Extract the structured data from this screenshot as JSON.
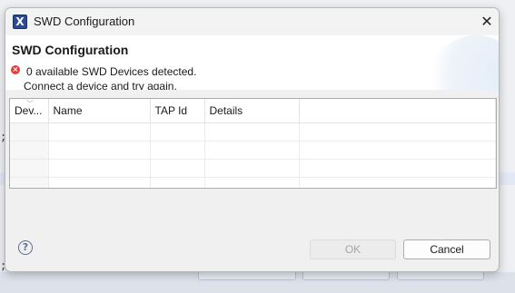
{
  "dialog": {
    "window_title": "SWD Configuration",
    "app_icon_glyph": "X",
    "close_glyph": "✕",
    "header_title": "SWD Configuration",
    "error_icon": "error-icon",
    "message_line1": "0 available SWD Devices detected.",
    "message_line2": "Connect a device and try again."
  },
  "table": {
    "columns": [
      "Dev...",
      "Name",
      "TAP Id",
      "Details"
    ],
    "rows": []
  },
  "buttons": {
    "help_glyph": "?",
    "ok_label": "OK",
    "ok_enabled": false,
    "cancel_label": "Cancel"
  },
  "background": {
    "glyphs": [
      ";",
      ";"
    ]
  },
  "colors": {
    "error": "#e2403a",
    "app_icon": "#2f4b8f"
  }
}
